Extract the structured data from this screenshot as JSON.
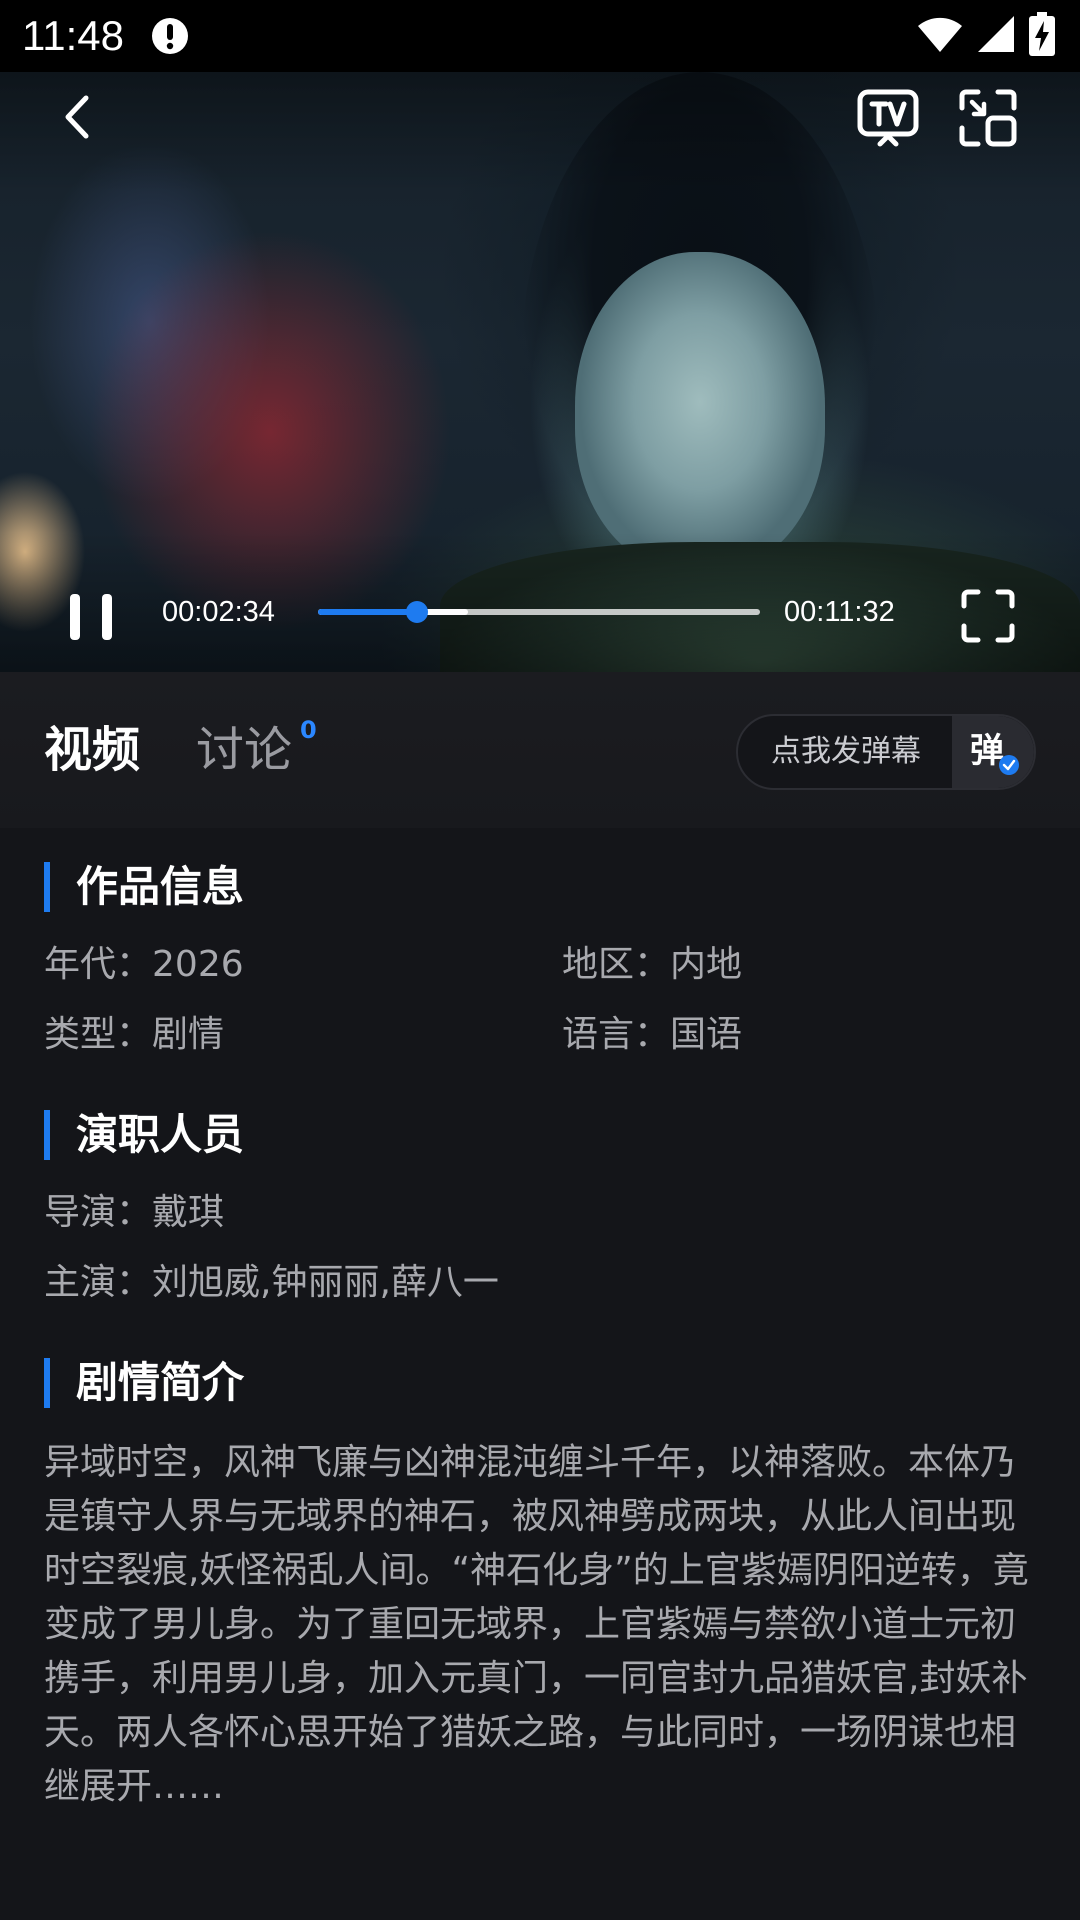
{
  "status_bar": {
    "time": "11:48",
    "icons": [
      "alert-icon",
      "wifi-icon",
      "signal-icon",
      "battery-charging-icon"
    ]
  },
  "player": {
    "current_time": "00:02:34",
    "total_time": "00:11:32",
    "progress_fraction": 0.223,
    "buffered_fraction": 0.34,
    "state": "playing",
    "accent_color": "#1e7bf0"
  },
  "tabs": {
    "video_label": "视频",
    "discuss_label": "讨论",
    "discuss_count": "0"
  },
  "danmaku": {
    "input_placeholder": "点我发弹幕",
    "toggle_label": "弹"
  },
  "info": {
    "title": "作品信息",
    "year_key": "年代：",
    "year_value": "2026",
    "region_key": "地区：",
    "region_value": "内地",
    "genre_key": "类型：",
    "genre_value": "剧情",
    "language_key": "语言：",
    "language_value": "国语"
  },
  "cast": {
    "title": "演职人员",
    "director_key": "导演：",
    "director_value": "戴琪",
    "starring_key": "主演：",
    "starring_value": "刘旭威,钟丽丽,薛八一"
  },
  "synopsis": {
    "title": "剧情简介",
    "text": "异域时空，风神飞廉与凶神混沌缠斗千年，以神落败。本体乃是镇守人界与无域界的神石，被风神劈成两块，从此人间出现时空裂痕,妖怪祸乱人间。“神石化身”的上官紫嫣阴阳逆转，竟变成了男儿身。为了重回无域界，上官紫嫣与禁欲小道士元初携手，利用男儿身，加入元真门，一同官封九品猎妖官,封妖补天。两人各怀心思开始了猎妖之路，与此同时，一场阴谋也相继展开……"
  }
}
